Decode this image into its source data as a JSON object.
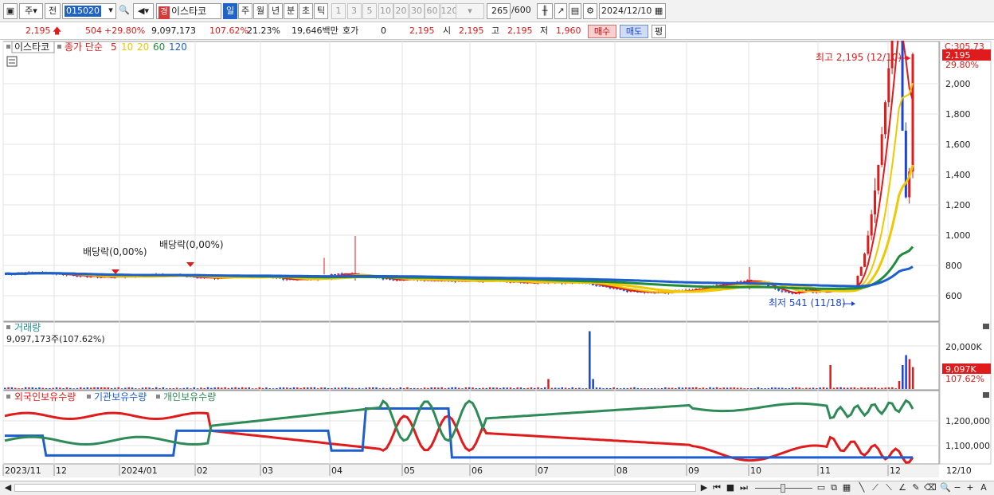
{
  "toolbar": {
    "market_type": "주",
    "prev_label": "전",
    "code": "015020",
    "name_tag": "경",
    "stock_name": "이스타코",
    "periods": [
      {
        "label": "일",
        "selected": true
      },
      {
        "label": "주",
        "selected": false
      },
      {
        "label": "월",
        "selected": false
      },
      {
        "label": "년",
        "selected": false
      },
      {
        "label": "분",
        "selected": false
      },
      {
        "label": "초",
        "selected": false
      },
      {
        "label": "틱",
        "selected": false
      }
    ],
    "intervals": [
      "1",
      "3",
      "5",
      "10",
      "20",
      "30",
      "60",
      "120"
    ],
    "count": "265",
    "count_total": "/600",
    "date": "2024/12/10"
  },
  "quote": {
    "price": "2,195",
    "change": "504",
    "change_pct": "+29.80%",
    "volume": "9,097,173",
    "volume_ratio": "107.62%",
    "turnover": "21.23%",
    "amount": "19,646백만",
    "hoga_label": "호가",
    "hoga_value": "0",
    "hoga_price": "2,195",
    "open_label": "시",
    "open": "2,195",
    "high_label": "고",
    "high": "2,195",
    "low_label": "저",
    "low": "1,960",
    "buy_label": "매수",
    "sell_label": "매도",
    "eval_label": "평"
  },
  "legend": {
    "name": "이스타코",
    "close_label": "종가 단순",
    "ma": [
      {
        "label": "5",
        "color": "#e01b1b"
      },
      {
        "label": "10",
        "color": "#f0c800"
      },
      {
        "label": "20",
        "color": "#f0c800"
      },
      {
        "label": "60",
        "color": "#1e8c3a"
      },
      {
        "label": "120",
        "color": "#1e5fd0"
      }
    ]
  },
  "annotations": {
    "high": "최고 2,195 (12/10)",
    "low": "최저 541 (11/18)",
    "dividend1": "배당락(0,00%)",
    "dividend2": "배당락(0,00%)"
  },
  "price_axis": {
    "top_label": "C:305.73",
    "current_tag": "2,195",
    "current_pct": "29.80%",
    "ticks": [
      "2,000",
      "1,800",
      "1,600",
      "1,400",
      "1,200",
      "1,000",
      "800",
      "600"
    ]
  },
  "volume_panel": {
    "title": "거래량",
    "value": "9,097,173주(107.62%)",
    "tick": "20,000K",
    "tag": "9,097K",
    "tag_pct": "107.62%"
  },
  "holding_panel": {
    "foreign": "외국인보유수량",
    "inst": "기관보유수량",
    "indiv": "개인보유수량",
    "ticks": [
      "1,200,000",
      "1,100,000"
    ]
  },
  "x_axis": {
    "labels": [
      "2023/11",
      "12",
      "2024/01",
      "02",
      "03",
      "04",
      "05",
      "06",
      "07",
      "08",
      "09",
      "10",
      "11",
      "12"
    ],
    "right_label": "12/10"
  },
  "colors": {
    "up": "#e01b1b",
    "down": "#1b45d8",
    "ma5": "#e01b1b",
    "ma10": "#f0c800",
    "ma20": "#f0c800",
    "ma60": "#1e8c3a",
    "ma120": "#1e5fd0",
    "foreign": "#e01b1b",
    "inst": "#1e5fd0",
    "indiv": "#2e8b57"
  }
}
